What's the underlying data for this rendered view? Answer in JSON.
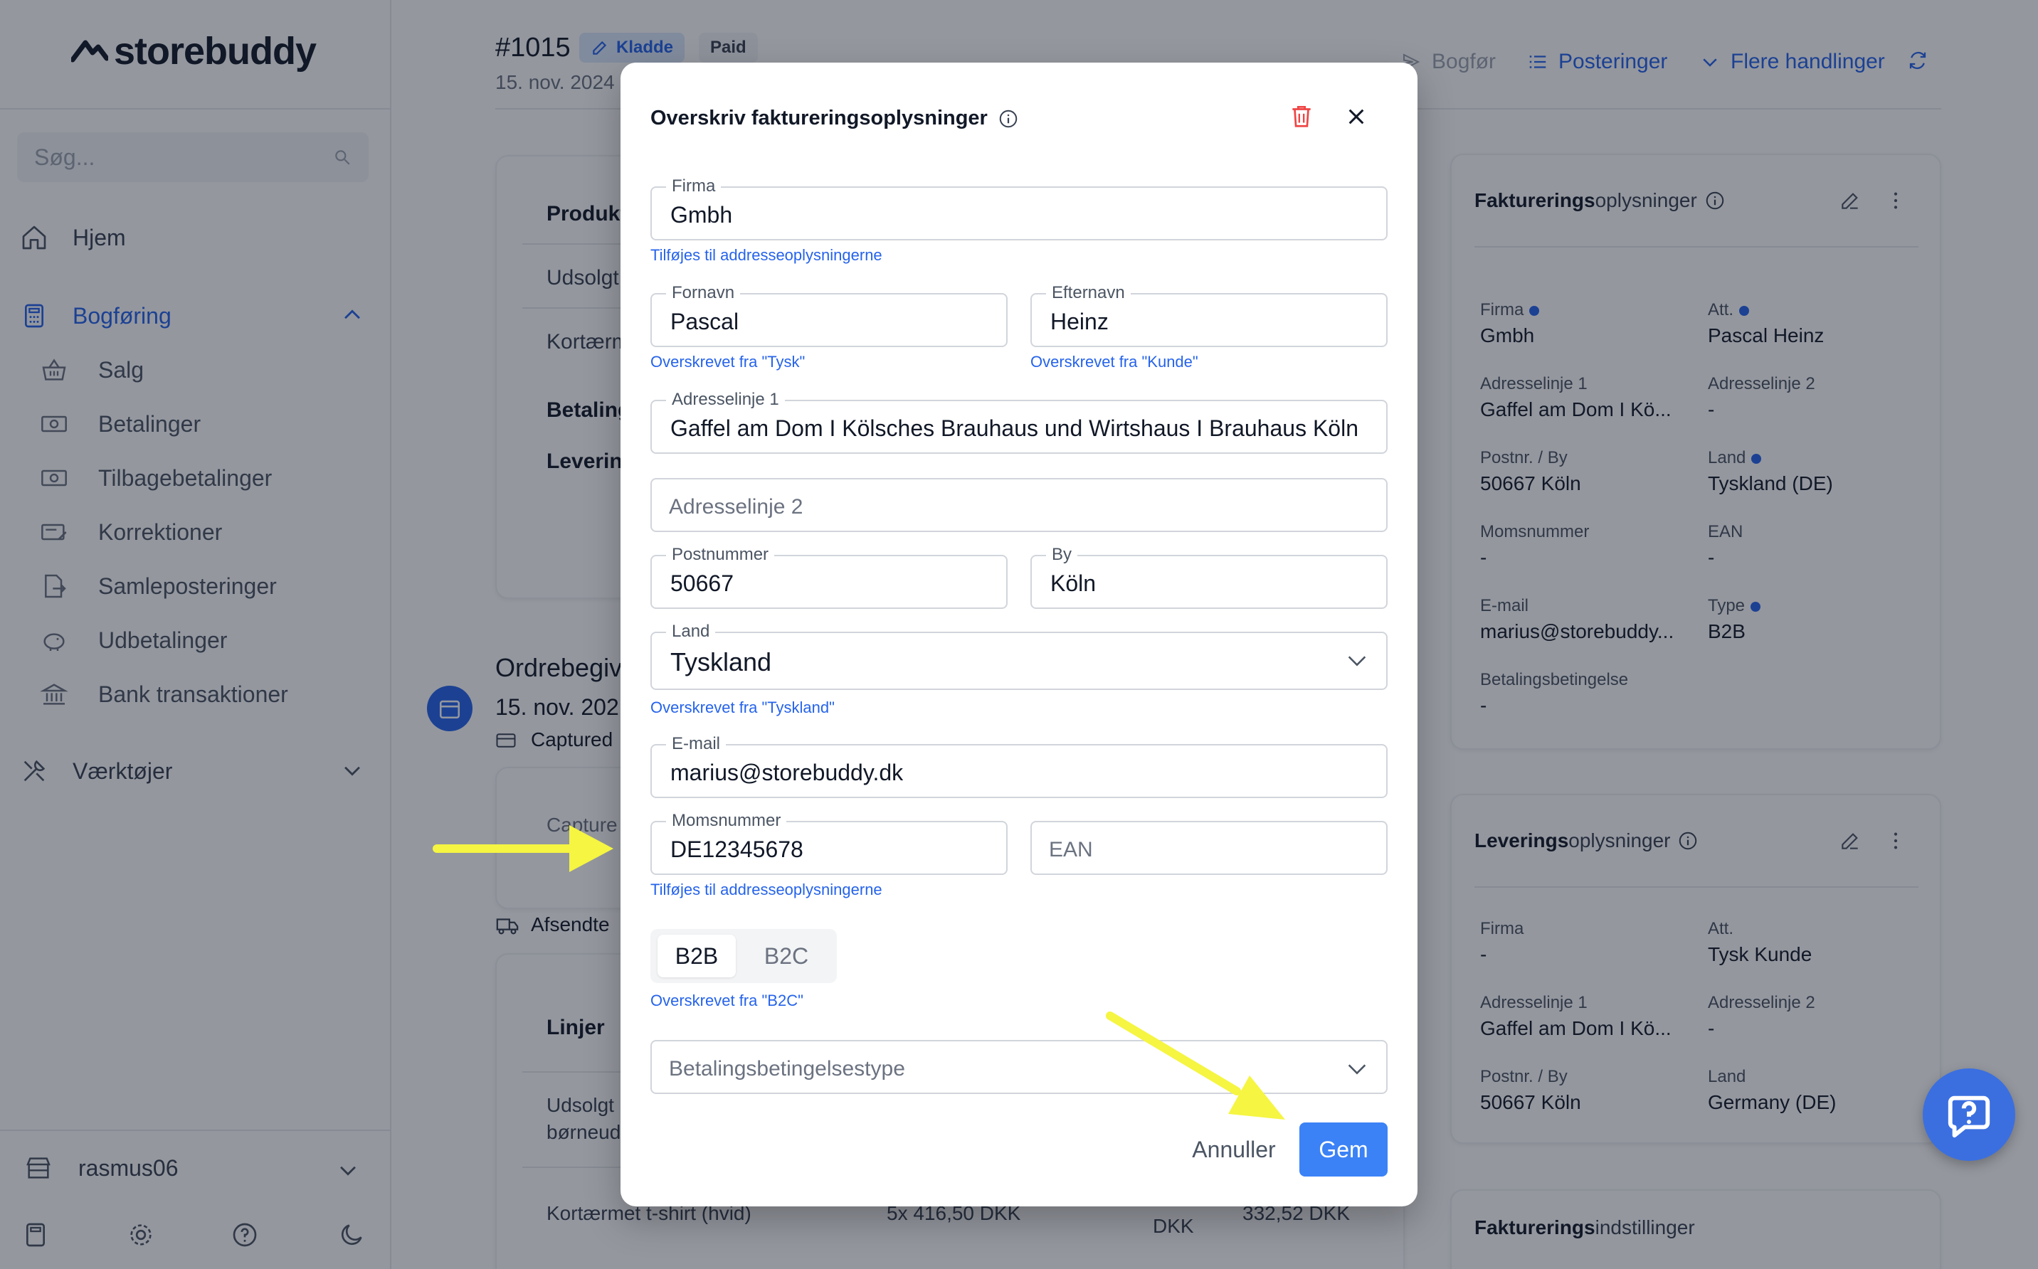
{
  "brand": {
    "name": "storebuddy"
  },
  "sidebar": {
    "search_placeholder": "Søg...",
    "items": [
      {
        "label": "Hjem"
      },
      {
        "label": "Bogføring"
      },
      {
        "label": "Værktøjer"
      }
    ],
    "sub_items": [
      {
        "label": "Salg"
      },
      {
        "label": "Betalinger"
      },
      {
        "label": "Tilbagebetalinger"
      },
      {
        "label": "Korrektioner"
      },
      {
        "label": "Samleposteringer"
      },
      {
        "label": "Udbetalinger"
      },
      {
        "label": "Bank transaktioner"
      }
    ],
    "store": "rasmus06"
  },
  "header": {
    "order_id": "#1015",
    "badge_draft": "Kladde",
    "badge_paid": "Paid",
    "date": "15. nov. 2024",
    "actions": {
      "post": "Bogfør",
      "entries": "Posteringer",
      "more": "Flere handlinger"
    }
  },
  "background": {
    "products_label": "Produkt",
    "sold_label": "Udsolgt",
    "short_label": "Kortærm",
    "payment_label": "Betaling",
    "delivery_label": "Leverin",
    "events_title": "Ordrebegiv",
    "events_date": "15. nov. 202",
    "captured": "Captured",
    "captured_row": "Capture",
    "shipped": "Afsendte",
    "lines_label": "Linjer",
    "line1_a": "Udsolgt",
    "line1_b": "børneud",
    "line2_name": "Kortærmet t-shirt (hvid)",
    "line2_qty": "5x 416,50 DKK",
    "line2_dkk": "DKK",
    "line2_total": "332,52 DKK"
  },
  "billing_panel": {
    "title_bold": "Fakturerings",
    "title_rest": "oplysninger",
    "fields": {
      "firma_label": "Firma",
      "firma_value": "Gmbh",
      "att_label": "Att.",
      "att_value": "Pascal Heinz",
      "addr1_label": "Adresselinje 1",
      "addr1_value": "Gaffel am Dom I Kö...",
      "addr2_label": "Adresselinje 2",
      "addr2_value": "-",
      "zip_label": "Postnr. / By",
      "zip_value": "50667 Köln",
      "country_label": "Land",
      "country_value": "Tyskland (DE)",
      "vat_label": "Momsnummer",
      "vat_value": "-",
      "ean_label": "EAN",
      "ean_value": "-",
      "email_label": "E-mail",
      "email_value": "marius@storebuddy...",
      "type_label": "Type",
      "type_value": "B2B",
      "terms_label": "Betalingsbetingelse",
      "terms_value": "-"
    }
  },
  "delivery_panel": {
    "title_bold": "Leverings",
    "title_rest": "oplysninger",
    "fields": {
      "firma_label": "Firma",
      "firma_value": "-",
      "att_label": "Att.",
      "att_value": "Tysk Kunde",
      "addr1_label": "Adresselinje 1",
      "addr1_value": "Gaffel am Dom I Kö...",
      "addr2_label": "Adresselinje 2",
      "addr2_value": "-",
      "zip_label": "Postnr. / By",
      "zip_value": "50667 Köln",
      "country_label": "Land",
      "country_value": "Germany (DE)"
    }
  },
  "settings_panel": {
    "title_bold": "Fakturerings",
    "title_rest": "indstillinger"
  },
  "modal": {
    "title": "Overskriv faktureringsoplysninger",
    "company": {
      "label": "Firma",
      "value": "Gmbh",
      "hint": "Tilføjes til addresseoplysningerne"
    },
    "first_name": {
      "label": "Fornavn",
      "value": "Pascal",
      "hint": "Overskrevet fra \"Tysk\""
    },
    "last_name": {
      "label": "Efternavn",
      "value": "Heinz",
      "hint": "Overskrevet fra \"Kunde\""
    },
    "address1": {
      "label": "Adresselinje 1",
      "value": "Gaffel am Dom I Kölsches Brauhaus und Wirtshaus I Brauhaus Köln"
    },
    "address2": {
      "placeholder": "Adresselinje 2"
    },
    "zip": {
      "label": "Postnummer",
      "value": "50667"
    },
    "city": {
      "label": "By",
      "value": "Köln"
    },
    "country": {
      "label": "Land",
      "value": "Tyskland",
      "hint": "Overskrevet fra \"Tyskland\""
    },
    "email": {
      "label": "E-mail",
      "value": "marius@storebuddy.dk"
    },
    "vat": {
      "label": "Momsnummer",
      "value": "DE12345678",
      "hint": "Tilføjes til addresseoplysningerne"
    },
    "ean": {
      "placeholder": "EAN"
    },
    "type": {
      "b2b": "B2B",
      "b2c": "B2C",
      "hint": "Overskrevet fra \"B2C\""
    },
    "payment_terms": {
      "placeholder": "Betalingsbetingelsestype"
    },
    "cancel": "Annuller",
    "save": "Gem"
  },
  "colors": {
    "accent": "#3b82f6",
    "link": "#2563eb",
    "danger": "#ef4444",
    "annotation_arrow": "#f5f542"
  }
}
